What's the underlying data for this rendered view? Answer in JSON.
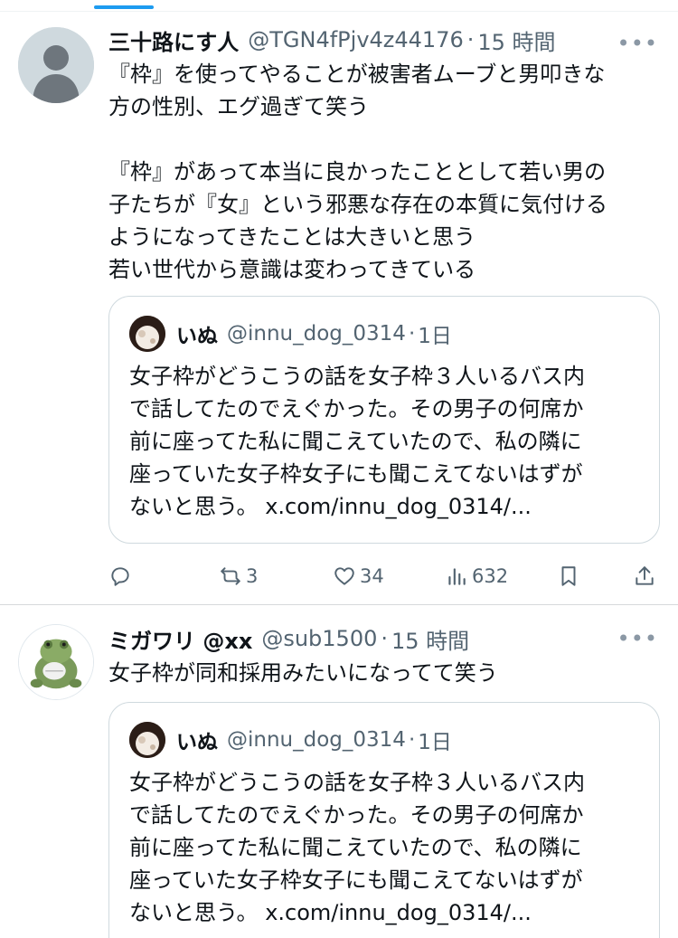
{
  "tweets": [
    {
      "author_name": "三十路にす人",
      "handle": "@TGN4fPjv4z44176",
      "separator": "·",
      "time": "15 時間",
      "more": "•••",
      "avatar_icon": "default-avatar-icon",
      "text": "『枠』を使ってやることが被害者ムーブと男叩きな\n方の性別、エグ過ぎて笑う\n\n『枠』があって本当に良かったこととして若い男の\n子たちが『女』という邪悪な存在の本質に気付ける\nようになってきたことは大きいと思う\n若い世代から意識は変わってきている",
      "quote": {
        "author_name": "いぬ",
        "handle": "@innu_dog_0314",
        "separator": "·",
        "time": "1日",
        "text": "女子枠がどうこうの話を女子枠３人いるバス内\nで話してたのでえぐかった。その男子の何席か\n前に座ってた私に聞こえていたので、私の隣に\n座っていた女子枠女子にも聞こえてないはずが\nないと思う。 ",
        "link": "x.com/innu_dog_0314/..."
      },
      "actions": {
        "reply_icon": "reply-icon",
        "retweet_icon": "retweet-icon",
        "retweets": "3",
        "like_icon": "heart-icon",
        "likes": "34",
        "views_icon": "views-icon",
        "views": "632",
        "bookmark_icon": "bookmark-icon",
        "share_icon": "share-icon"
      }
    },
    {
      "author_name": "ミガワリ @xx",
      "handle": "@sub1500",
      "separator": "·",
      "time": "15 時間",
      "more": "•••",
      "avatar_icon": "frog-avatar-icon",
      "text": "女子枠が同和採用みたいになってて笑う",
      "quote": {
        "author_name": "いぬ",
        "handle": "@innu_dog_0314",
        "separator": "·",
        "time": "1日",
        "text": "女子枠がどうこうの話を女子枠３人いるバス内\nで話してたのでえぐかった。その男子の何席か\n前に座ってた私に聞こえていたので、私の隣に\n座っていた女子枠女子にも聞こえてないはずが\nないと思う。 ",
        "link": "x.com/innu_dog_0314/..."
      }
    }
  ],
  "colors": {
    "accent": "#1d9bf0",
    "text_primary": "#0f1419",
    "text_secondary": "#536471",
    "border": "#cfd9de"
  }
}
